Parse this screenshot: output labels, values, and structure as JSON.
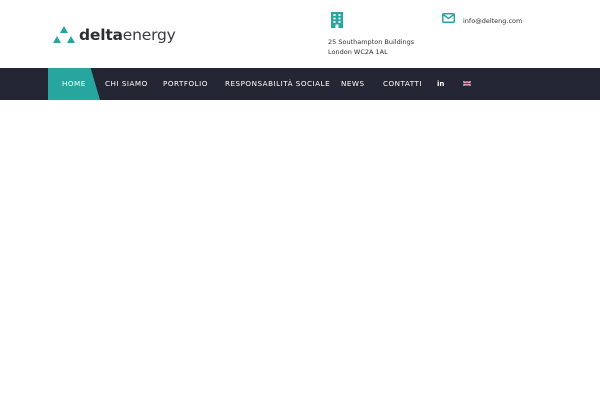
{
  "brand": {
    "name_bold": "delta",
    "name_light": "energy",
    "color": "#27a6a0"
  },
  "contact": {
    "address_icon": "building-icon",
    "address_line1": "25 Southampton Buildings",
    "address_line2": "London WC2A 1AL",
    "email_icon": "envelope-icon",
    "email": "info@delteng.com"
  },
  "nav": {
    "background": "#252634",
    "active_color": "#27a6a0",
    "items": [
      {
        "label": "HOME",
        "active": true
      },
      {
        "label": "CHI SIAMO"
      },
      {
        "label": "PORTFOLIO"
      },
      {
        "label": "RESPONSABILITÀ SOCIALE"
      },
      {
        "label": "NEWS"
      },
      {
        "label": "CONTATTI"
      },
      {
        "label": "in",
        "icon": "linkedin-icon"
      },
      {
        "icon": "uk-flag-icon"
      }
    ]
  }
}
